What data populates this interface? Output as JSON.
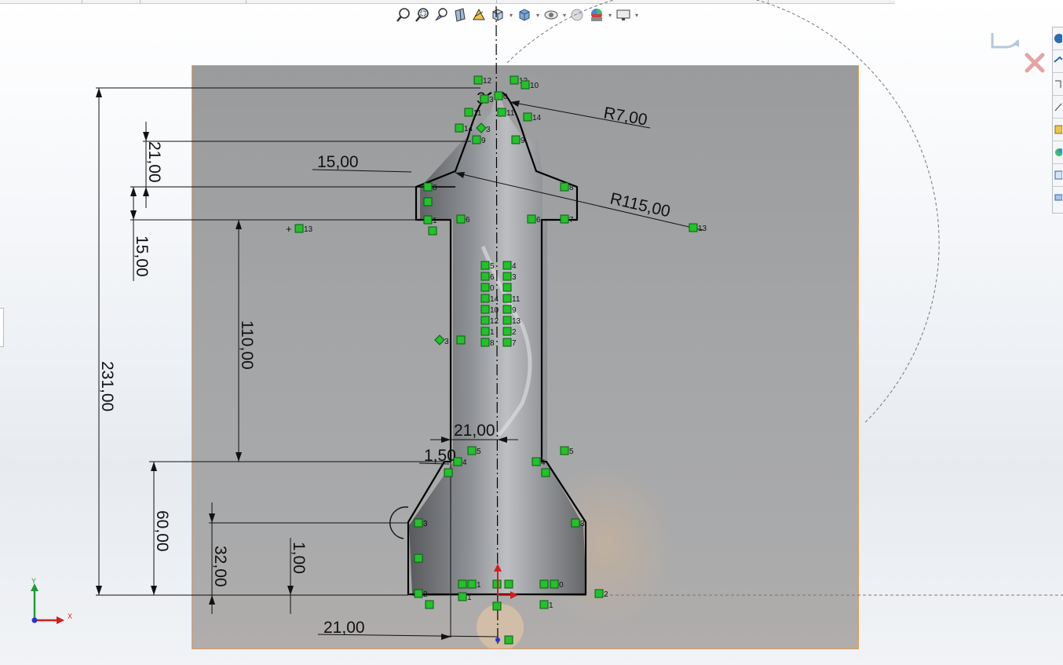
{
  "toolbar": {
    "icons": [
      "zoom-to-fit-icon",
      "zoom-to-area-icon",
      "previous-view-icon",
      "section-view-icon",
      "dynamic-annotation-icon",
      "view-orientation-icon",
      "display-style-icon",
      "hide-show-items-icon",
      "edit-appearance-icon",
      "apply-scene-icon",
      "view-settings-icon"
    ]
  },
  "dimensions": {
    "r7": "R7,00",
    "r115": "R115,00",
    "d21_top": "21,00",
    "d15_flap": "15,00",
    "d15_side": "15,00",
    "d110": "110,00",
    "d231": "231,00",
    "d21_body": "21,00",
    "d150": "1,50",
    "d60": "60,00",
    "d32": "32,00",
    "d100": "1,00",
    "d21_bottom": "21,00",
    "angle": "3"
  },
  "relations": [
    "12",
    "12",
    "10",
    "0",
    "3",
    "11",
    "11",
    "14",
    "14",
    "3",
    "9",
    "9",
    "8",
    "8",
    "1",
    "6",
    "6",
    "7",
    "13",
    "13",
    "5",
    "4",
    "6",
    "3",
    "0",
    "14",
    "11",
    "10",
    "9",
    "12",
    "13",
    "1",
    "2",
    "8",
    "7",
    "3",
    "5",
    "5",
    "4",
    "4",
    "3",
    "3",
    "1",
    "1",
    "0",
    "0",
    "2",
    "2",
    "1",
    "1"
  ],
  "axes": {
    "x": "X",
    "y": "Y"
  },
  "colors": {
    "relation": "#22c22a",
    "sketch": "#000000",
    "dimension": "#111111",
    "origin_x": "#d21f1f",
    "origin_y": "#1d9a33",
    "origin_z": "#2433d6",
    "photo_border": "#e29a52"
  }
}
